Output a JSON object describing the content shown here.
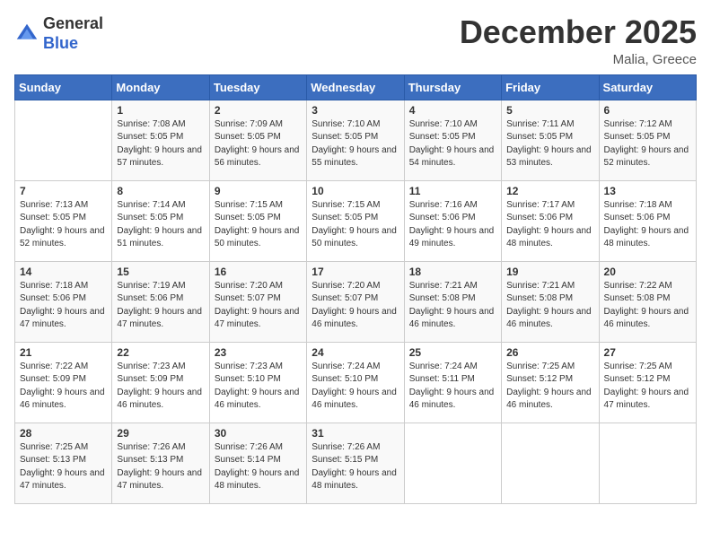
{
  "logo": {
    "general": "General",
    "blue": "Blue"
  },
  "title": "December 2025",
  "location": "Malia, Greece",
  "days_of_week": [
    "Sunday",
    "Monday",
    "Tuesday",
    "Wednesday",
    "Thursday",
    "Friday",
    "Saturday"
  ],
  "weeks": [
    [
      {
        "day": "",
        "sunrise": "",
        "sunset": "",
        "daylight": ""
      },
      {
        "day": "1",
        "sunrise": "Sunrise: 7:08 AM",
        "sunset": "Sunset: 5:05 PM",
        "daylight": "Daylight: 9 hours and 57 minutes."
      },
      {
        "day": "2",
        "sunrise": "Sunrise: 7:09 AM",
        "sunset": "Sunset: 5:05 PM",
        "daylight": "Daylight: 9 hours and 56 minutes."
      },
      {
        "day": "3",
        "sunrise": "Sunrise: 7:10 AM",
        "sunset": "Sunset: 5:05 PM",
        "daylight": "Daylight: 9 hours and 55 minutes."
      },
      {
        "day": "4",
        "sunrise": "Sunrise: 7:10 AM",
        "sunset": "Sunset: 5:05 PM",
        "daylight": "Daylight: 9 hours and 54 minutes."
      },
      {
        "day": "5",
        "sunrise": "Sunrise: 7:11 AM",
        "sunset": "Sunset: 5:05 PM",
        "daylight": "Daylight: 9 hours and 53 minutes."
      },
      {
        "day": "6",
        "sunrise": "Sunrise: 7:12 AM",
        "sunset": "Sunset: 5:05 PM",
        "daylight": "Daylight: 9 hours and 52 minutes."
      }
    ],
    [
      {
        "day": "7",
        "sunrise": "Sunrise: 7:13 AM",
        "sunset": "Sunset: 5:05 PM",
        "daylight": "Daylight: 9 hours and 52 minutes."
      },
      {
        "day": "8",
        "sunrise": "Sunrise: 7:14 AM",
        "sunset": "Sunset: 5:05 PM",
        "daylight": "Daylight: 9 hours and 51 minutes."
      },
      {
        "day": "9",
        "sunrise": "Sunrise: 7:15 AM",
        "sunset": "Sunset: 5:05 PM",
        "daylight": "Daylight: 9 hours and 50 minutes."
      },
      {
        "day": "10",
        "sunrise": "Sunrise: 7:15 AM",
        "sunset": "Sunset: 5:05 PM",
        "daylight": "Daylight: 9 hours and 50 minutes."
      },
      {
        "day": "11",
        "sunrise": "Sunrise: 7:16 AM",
        "sunset": "Sunset: 5:06 PM",
        "daylight": "Daylight: 9 hours and 49 minutes."
      },
      {
        "day": "12",
        "sunrise": "Sunrise: 7:17 AM",
        "sunset": "Sunset: 5:06 PM",
        "daylight": "Daylight: 9 hours and 48 minutes."
      },
      {
        "day": "13",
        "sunrise": "Sunrise: 7:18 AM",
        "sunset": "Sunset: 5:06 PM",
        "daylight": "Daylight: 9 hours and 48 minutes."
      }
    ],
    [
      {
        "day": "14",
        "sunrise": "Sunrise: 7:18 AM",
        "sunset": "Sunset: 5:06 PM",
        "daylight": "Daylight: 9 hours and 47 minutes."
      },
      {
        "day": "15",
        "sunrise": "Sunrise: 7:19 AM",
        "sunset": "Sunset: 5:06 PM",
        "daylight": "Daylight: 9 hours and 47 minutes."
      },
      {
        "day": "16",
        "sunrise": "Sunrise: 7:20 AM",
        "sunset": "Sunset: 5:07 PM",
        "daylight": "Daylight: 9 hours and 47 minutes."
      },
      {
        "day": "17",
        "sunrise": "Sunrise: 7:20 AM",
        "sunset": "Sunset: 5:07 PM",
        "daylight": "Daylight: 9 hours and 46 minutes."
      },
      {
        "day": "18",
        "sunrise": "Sunrise: 7:21 AM",
        "sunset": "Sunset: 5:08 PM",
        "daylight": "Daylight: 9 hours and 46 minutes."
      },
      {
        "day": "19",
        "sunrise": "Sunrise: 7:21 AM",
        "sunset": "Sunset: 5:08 PM",
        "daylight": "Daylight: 9 hours and 46 minutes."
      },
      {
        "day": "20",
        "sunrise": "Sunrise: 7:22 AM",
        "sunset": "Sunset: 5:08 PM",
        "daylight": "Daylight: 9 hours and 46 minutes."
      }
    ],
    [
      {
        "day": "21",
        "sunrise": "Sunrise: 7:22 AM",
        "sunset": "Sunset: 5:09 PM",
        "daylight": "Daylight: 9 hours and 46 minutes."
      },
      {
        "day": "22",
        "sunrise": "Sunrise: 7:23 AM",
        "sunset": "Sunset: 5:09 PM",
        "daylight": "Daylight: 9 hours and 46 minutes."
      },
      {
        "day": "23",
        "sunrise": "Sunrise: 7:23 AM",
        "sunset": "Sunset: 5:10 PM",
        "daylight": "Daylight: 9 hours and 46 minutes."
      },
      {
        "day": "24",
        "sunrise": "Sunrise: 7:24 AM",
        "sunset": "Sunset: 5:10 PM",
        "daylight": "Daylight: 9 hours and 46 minutes."
      },
      {
        "day": "25",
        "sunrise": "Sunrise: 7:24 AM",
        "sunset": "Sunset: 5:11 PM",
        "daylight": "Daylight: 9 hours and 46 minutes."
      },
      {
        "day": "26",
        "sunrise": "Sunrise: 7:25 AM",
        "sunset": "Sunset: 5:12 PM",
        "daylight": "Daylight: 9 hours and 46 minutes."
      },
      {
        "day": "27",
        "sunrise": "Sunrise: 7:25 AM",
        "sunset": "Sunset: 5:12 PM",
        "daylight": "Daylight: 9 hours and 47 minutes."
      }
    ],
    [
      {
        "day": "28",
        "sunrise": "Sunrise: 7:25 AM",
        "sunset": "Sunset: 5:13 PM",
        "daylight": "Daylight: 9 hours and 47 minutes."
      },
      {
        "day": "29",
        "sunrise": "Sunrise: 7:26 AM",
        "sunset": "Sunset: 5:13 PM",
        "daylight": "Daylight: 9 hours and 47 minutes."
      },
      {
        "day": "30",
        "sunrise": "Sunrise: 7:26 AM",
        "sunset": "Sunset: 5:14 PM",
        "daylight": "Daylight: 9 hours and 48 minutes."
      },
      {
        "day": "31",
        "sunrise": "Sunrise: 7:26 AM",
        "sunset": "Sunset: 5:15 PM",
        "daylight": "Daylight: 9 hours and 48 minutes."
      },
      {
        "day": "",
        "sunrise": "",
        "sunset": "",
        "daylight": ""
      },
      {
        "day": "",
        "sunrise": "",
        "sunset": "",
        "daylight": ""
      },
      {
        "day": "",
        "sunrise": "",
        "sunset": "",
        "daylight": ""
      }
    ]
  ]
}
